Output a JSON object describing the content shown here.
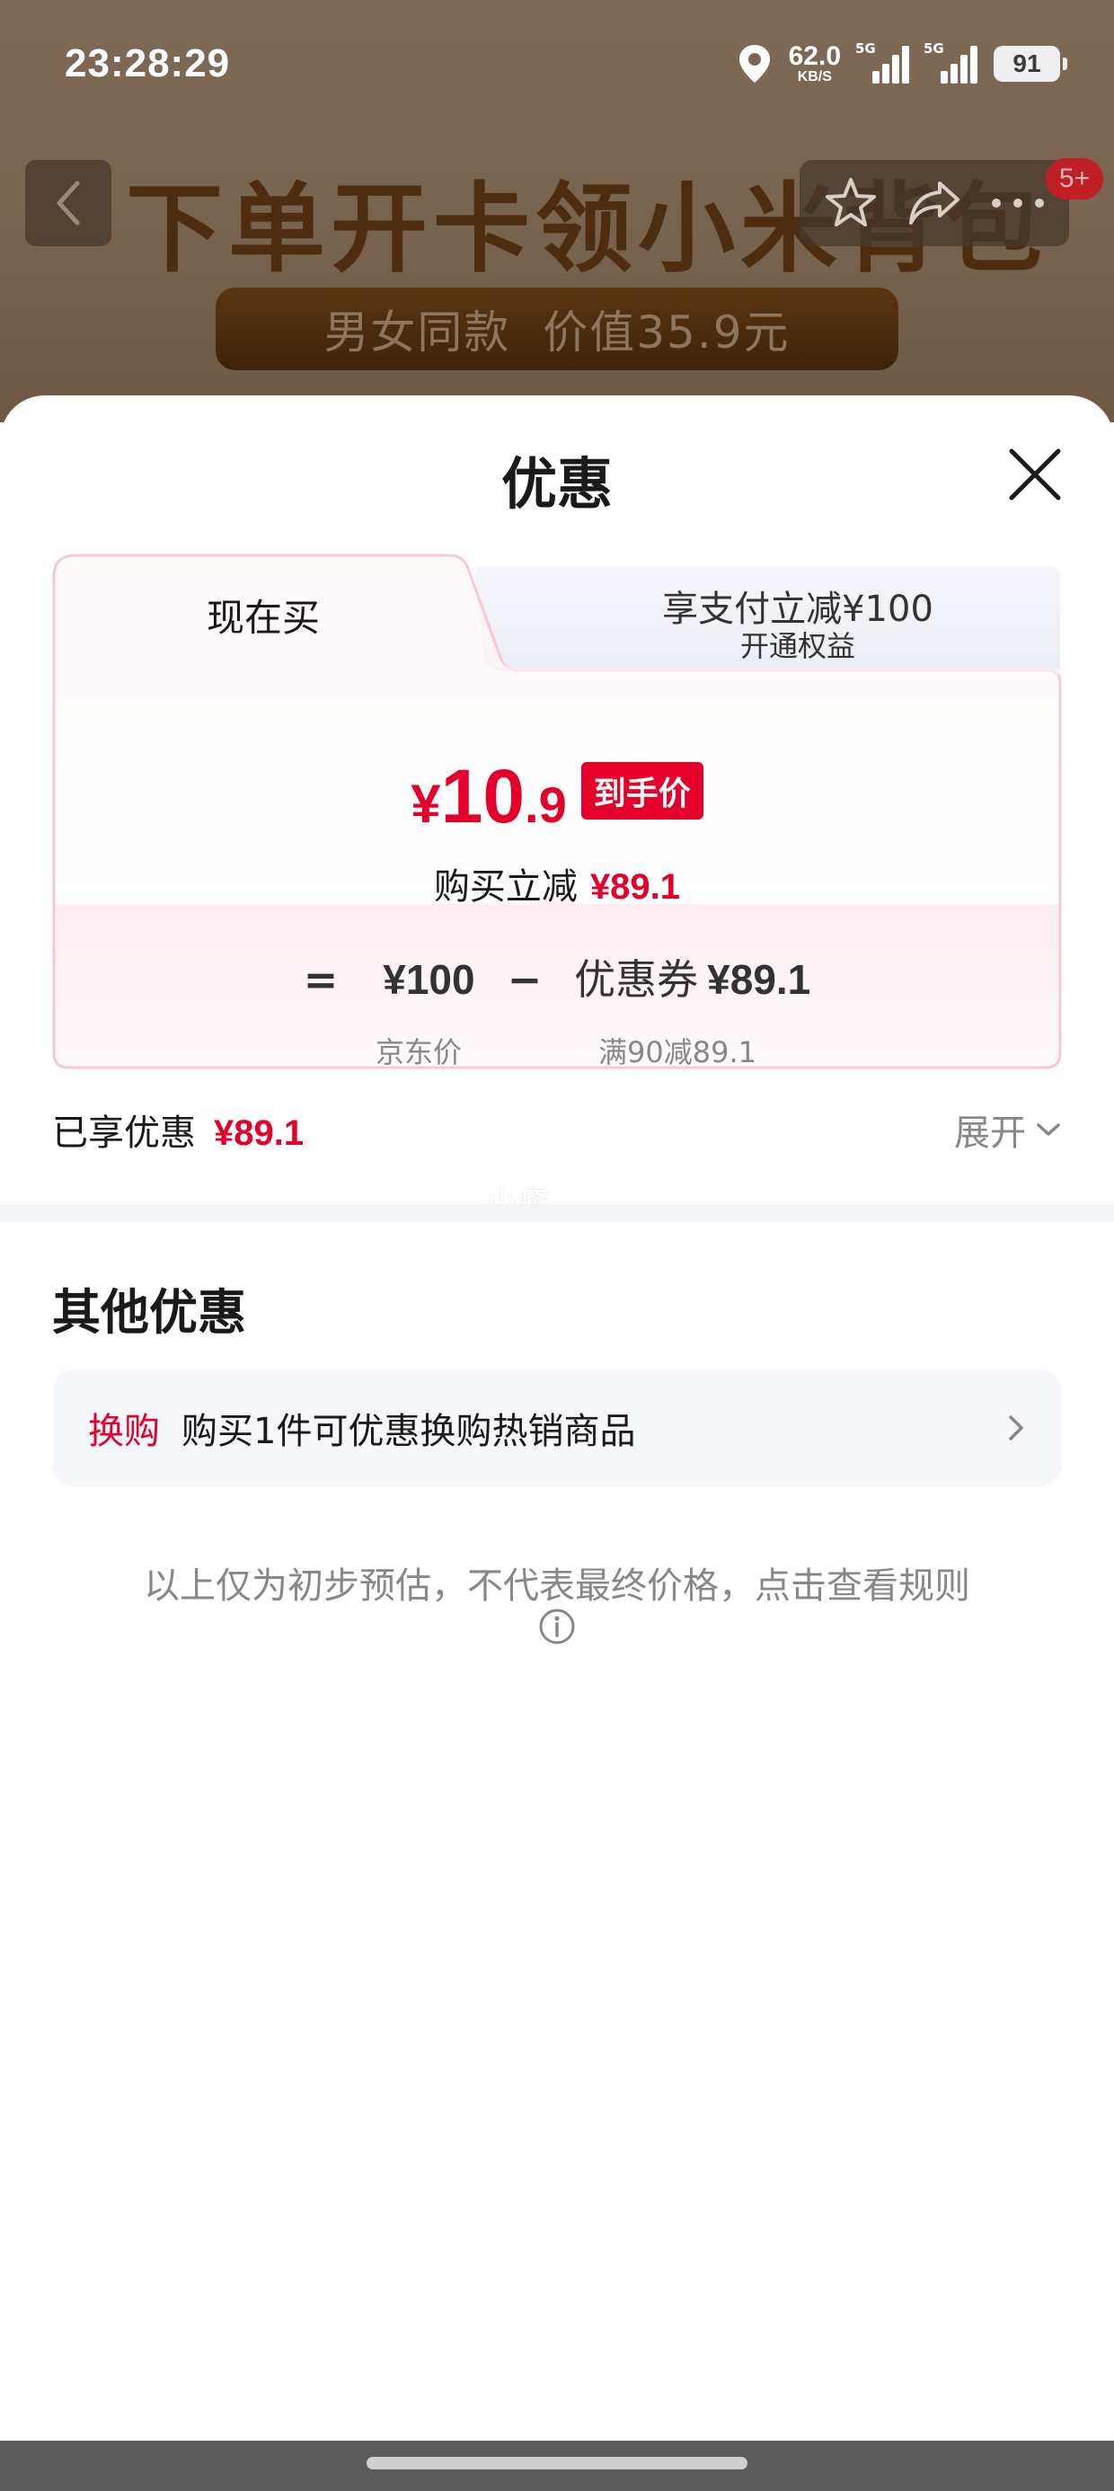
{
  "status_bar": {
    "time": "23:28:29",
    "speed_value": "62.0",
    "speed_unit": "KB/S",
    "signal_tag": "5G",
    "battery": "91"
  },
  "background_page": {
    "banner_title": "下单开卡领小米背包",
    "banner_subtitle": "男女同款  价值35.9元",
    "badge": "5+"
  },
  "sheet": {
    "title": "优惠",
    "tabs": [
      {
        "label": "现在买"
      },
      {
        "label": "享支付立减¥100",
        "sub": "开通权益"
      }
    ],
    "price": {
      "currency": "¥",
      "integer": "10",
      "decimal": ".9",
      "tag": "到手价"
    },
    "buy_reduce": {
      "label": "购买立减",
      "amount": "¥89.1"
    },
    "formula": {
      "equals": "=",
      "jd_price": "¥100",
      "minus": "−",
      "coupon_label": "优惠券",
      "coupon_value": "¥89.1",
      "jd_price_label": "京东价",
      "coupon_rule": "满90减89.1"
    },
    "enjoyed": {
      "label": "已享优惠",
      "amount": "¥89.1"
    },
    "expand_label": "展开",
    "watermark": "小癒",
    "other": {
      "title": "其他优惠",
      "items": [
        {
          "tag": "换购",
          "text": "购买1件可优惠换购热销商品"
        }
      ]
    },
    "note": "以上仅为初步预估，不代表最终价格，点击查看规则"
  },
  "colors": {
    "accent_red": "#e4002b",
    "card_border": "#f7c9d4"
  }
}
